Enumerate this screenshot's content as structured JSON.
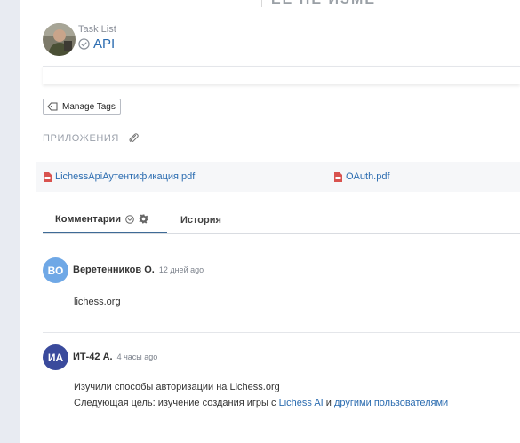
{
  "top_remnant": "ЕЕ НЕ ИЗМЕ",
  "task": {
    "breadcrumb": "Task List",
    "title": "API"
  },
  "tags": {
    "button_label": "Manage Tags"
  },
  "attachments": {
    "heading": "ПРИЛОЖЕНИЯ",
    "files": [
      "LichessApiАутентификация.pdf",
      "OAuth.pdf"
    ]
  },
  "tabs": {
    "comments": "Комментарии",
    "history": "История"
  },
  "comments": [
    {
      "initials": "ВО",
      "author": "Веретенников О.",
      "time": "12 дней ago",
      "avatar_color": "#6fa8e6",
      "text": "lichess.org"
    },
    {
      "initials": "ИА",
      "author": "ИТ-42 А.",
      "time": "4 часы ago",
      "avatar_color": "#3a4a9c",
      "line1": "Изучили способы авторизации на Lichess.org",
      "line2_pre": "Следующая цель: изучение создания игры с ",
      "link1": "Lichess AI",
      "line2_mid": " и ",
      "link2": "другими пользователями"
    }
  ],
  "colors": {
    "accent": "#2b6cb0",
    "tab_active": "#3e6b96",
    "pdf_red": "#d9534f"
  }
}
